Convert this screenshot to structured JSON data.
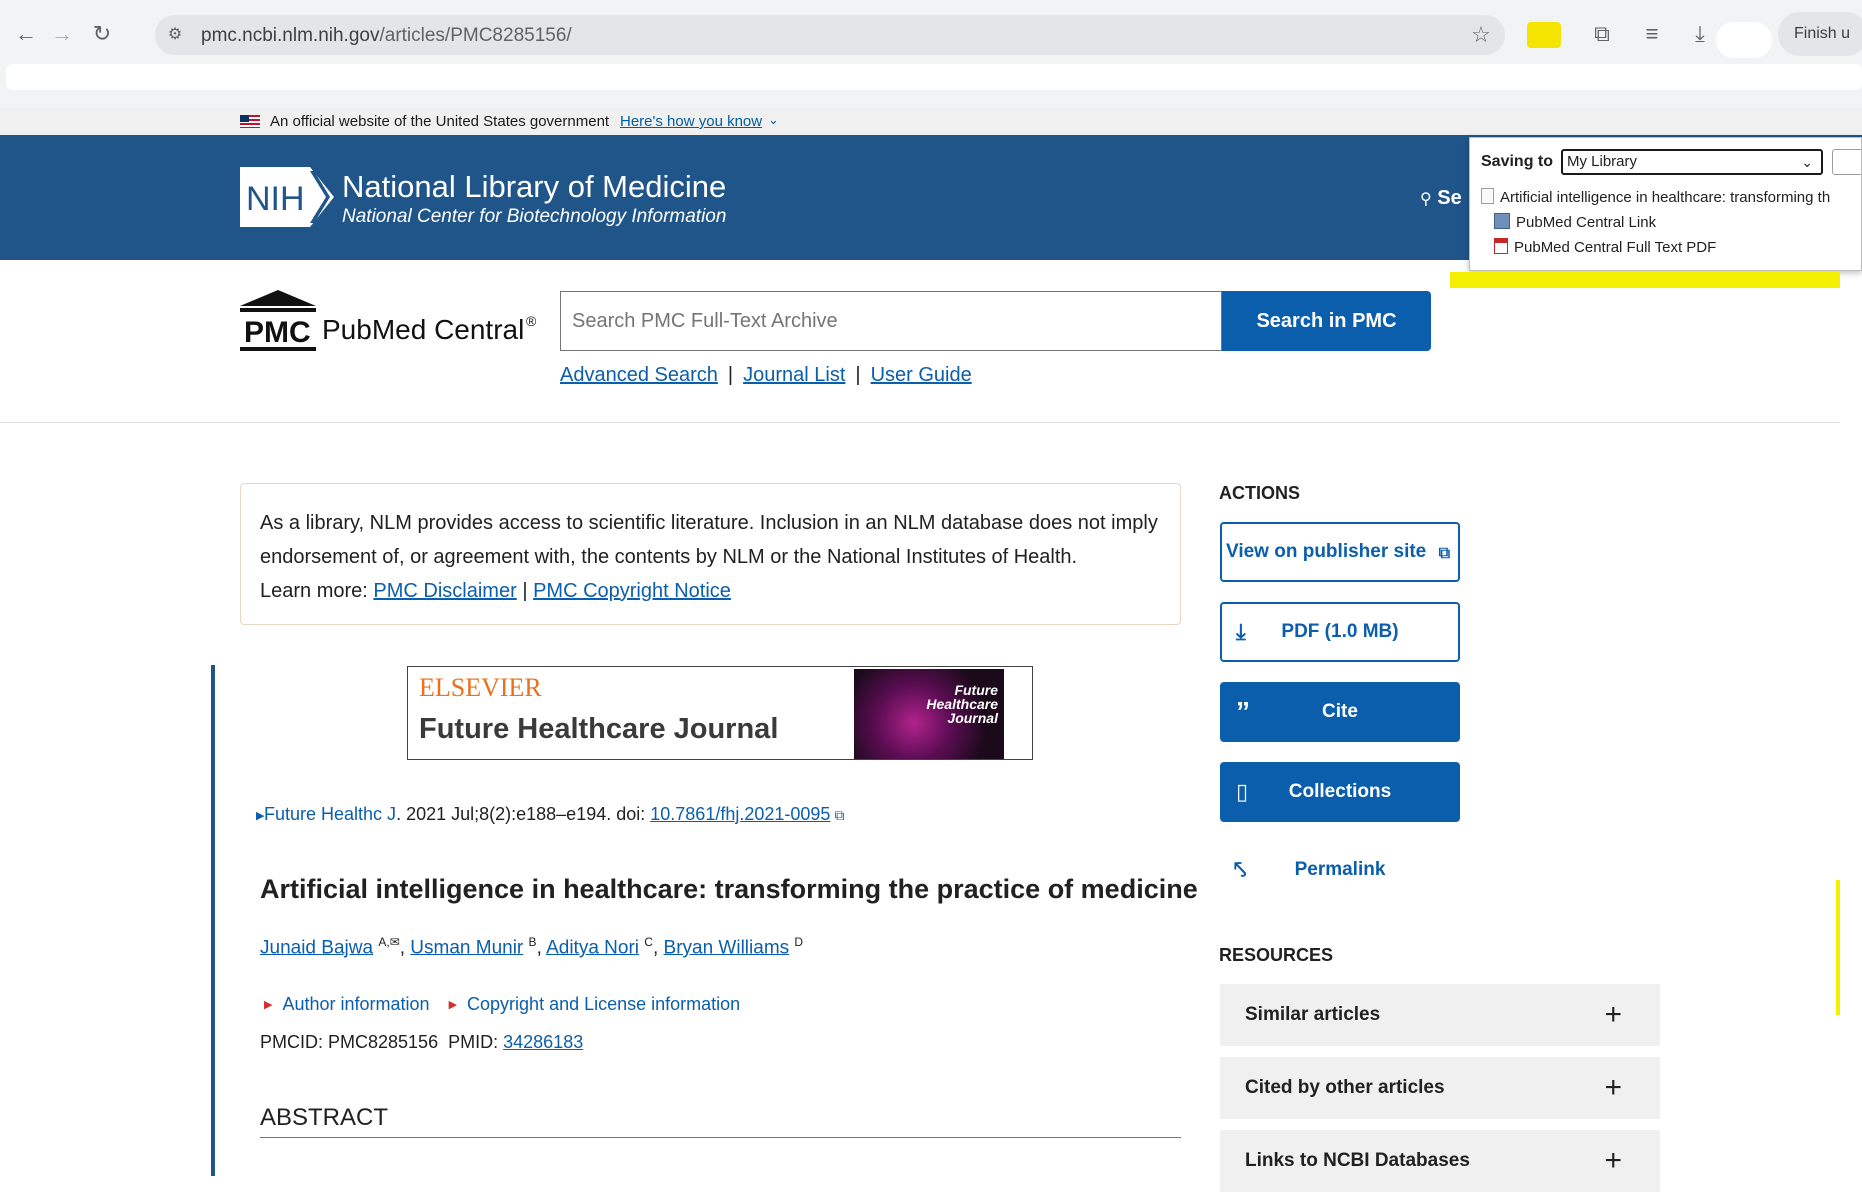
{
  "browser": {
    "url_host": "pmc.ncbi.nlm.nih.gov",
    "url_path": "/articles/PMC8285156/",
    "finish_label": "Finish u"
  },
  "gov_banner": {
    "text": "An official website of the United States government",
    "link": "Here's how you know"
  },
  "nlm": {
    "logo_text": "NIH",
    "title": "National Library of Medicine",
    "subtitle": "National Center for Biotechnology Information",
    "search_label": "Se"
  },
  "save_popup": {
    "label": "Saving to",
    "selected": "My Library",
    "items": [
      "Artificial intelligence in healthcare: transforming th",
      "PubMed Central Link",
      "PubMed Central Full Text PDF"
    ]
  },
  "pmc": {
    "logo_abbr": "PMC",
    "logo_name": "PubMed Central",
    "logo_reg": "®",
    "search_placeholder": "Search PMC Full-Text Archive",
    "search_button": "Search in PMC",
    "links": [
      "Advanced Search",
      "Journal List",
      "User Guide"
    ]
  },
  "disclaimer": {
    "text": "As a library, NLM provides access to scientific literature. Inclusion in an NLM database does not imply endorsement of, or agreement with, the contents by NLM or the National Institutes of Health.",
    "learn_more": "Learn more:",
    "link1": "PMC Disclaimer",
    "sep": "|",
    "link2": "PMC Copyright Notice"
  },
  "journal_banner": {
    "publisher": "ELSEVIER",
    "journal": "Future Healthcare Journal",
    "cover_text": "Future Healthcare Journal"
  },
  "citation": {
    "journal": "Future Healthc J",
    "details": ". 2021 Jul;8(2):e188–e194. doi: ",
    "doi": "10.7861/fhj.2021-0095"
  },
  "article": {
    "title": "Artificial intelligence in healthcare: transforming the practice of medicine",
    "authors": [
      {
        "name": "Junaid Bajwa",
        "sup": "A,✉"
      },
      {
        "name": "Usman Munir",
        "sup": "B"
      },
      {
        "name": "Aditya Nori",
        "sup": "C"
      },
      {
        "name": "Bryan Williams",
        "sup": "D"
      }
    ],
    "author_info": "Author information",
    "copyright_info": "Copyright and License information",
    "pmcid_label": "PMCID: PMC8285156",
    "pmid_label": "PMID:",
    "pmid": "34286183",
    "abstract_heading": "ABSTRACT"
  },
  "sidebar": {
    "actions_heading": "ACTIONS",
    "publisher_btn": "View on publisher site",
    "pdf_btn": "PDF (1.0 MB)",
    "cite_btn": "Cite",
    "collections_btn": "Collections",
    "permalink_btn": "Permalink",
    "resources_heading": "RESOURCES",
    "resources": [
      "Similar articles",
      "Cited by other articles",
      "Links to NCBI Databases"
    ]
  },
  "colors": {
    "nlm_blue": "#20558a",
    "pmc_blue": "#0b5eab",
    "highlight_yellow": "#f5ef00"
  }
}
